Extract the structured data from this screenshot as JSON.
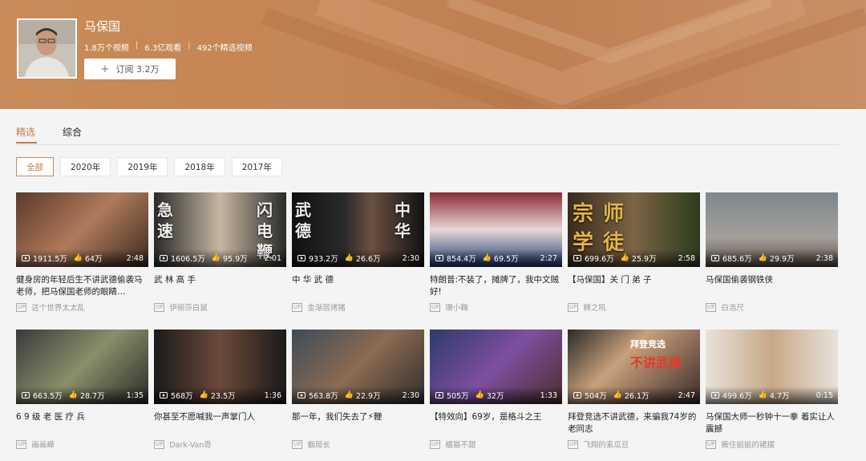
{
  "channel": {
    "name": "马保国",
    "stats": [
      "1.8万个视频",
      "6.3亿观看",
      "492个精选视频"
    ],
    "subscribe_label": "订阅 3.2万"
  },
  "tabs": [
    {
      "label": "精选",
      "active": true
    },
    {
      "label": "综合",
      "active": false
    }
  ],
  "filters": [
    {
      "label": "全部",
      "active": true
    },
    {
      "label": "2020年",
      "active": false
    },
    {
      "label": "2019年",
      "active": false
    },
    {
      "label": "2018年",
      "active": false
    },
    {
      "label": "2017年",
      "active": false
    }
  ],
  "videos": [
    {
      "views": "1911.5万",
      "likes": "64万",
      "duration": "2:48",
      "title": "健身房的年轻后生不讲武德偷袭马老师，把马保国老师的眼睛…",
      "author": "这个世界太太乱",
      "overlay": []
    },
    {
      "views": "1606.5万",
      "likes": "95.9万",
      "duration": "2:01",
      "title": "武 林 高 手",
      "author": "伊丽莎白鼠",
      "overlay": [
        "闪",
        "电",
        "鞭",
        "急",
        "速"
      ]
    },
    {
      "views": "933.2万",
      "likes": "26.6万",
      "duration": "2:30",
      "title": "中 华 武 德",
      "author": "金渐层烤猪",
      "overlay": [
        "中",
        "华",
        "武",
        "德"
      ]
    },
    {
      "views": "854.4万",
      "likes": "69.5万",
      "duration": "2:27",
      "title": "特朗普:不装了，摊牌了，我中文贼好!",
      "author": "珊小鞠",
      "overlay": []
    },
    {
      "views": "699.6万",
      "likes": "25.9万",
      "duration": "2:58",
      "title": "【马保国】关 门 弟 子",
      "author": "狮之吼",
      "overlay": [
        "宗",
        "师",
        "学",
        "徒"
      ]
    },
    {
      "views": "685.6万",
      "likes": "29.9万",
      "duration": "2:38",
      "title": "马保国偷袭钢铁侠",
      "author": "白浩尺",
      "overlay": []
    },
    {
      "views": "663.5万",
      "likes": "28.7万",
      "duration": "1:35",
      "title": "6 9 级 老 医 疗 兵",
      "author": "画画嵘",
      "overlay": []
    },
    {
      "views": "568万",
      "likes": "23.5万",
      "duration": "1:36",
      "title": "你甚至不愿喊我一声掌门人",
      "author": "Dark-Van奇",
      "overlay": []
    },
    {
      "views": "563.8万",
      "likes": "22.9万",
      "duration": "2:30",
      "title": "那一年，我们失去了⚡鞭",
      "author": "蝈局长",
      "overlay": []
    },
    {
      "views": "505万",
      "likes": "32万",
      "duration": "1:33",
      "title": "【特效向】69岁，是格斗之王",
      "author": "橘猫不甜",
      "overlay": []
    },
    {
      "views": "504万",
      "likes": "26.1万",
      "duration": "2:47",
      "title": "拜登竞选不讲武德，来骗我74岁的老同志",
      "author": "飞翔的素瓜豆",
      "overlay": [
        "拜登竞选",
        "不讲武德"
      ]
    },
    {
      "views": "499.6万",
      "likes": "4.7万",
      "duration": "0:15",
      "title": "马保国大师一秒钟十一拳 着实让人震撼",
      "author": "撅住姐姐的裙摆",
      "overlay": []
    }
  ],
  "icons": {
    "play": "play-count-icon",
    "like": "thumbs-up-icon",
    "up": "uploader-icon",
    "plus": "plus-icon"
  },
  "colors": {
    "accent": "#c27b48",
    "banner": "#c48552"
  }
}
